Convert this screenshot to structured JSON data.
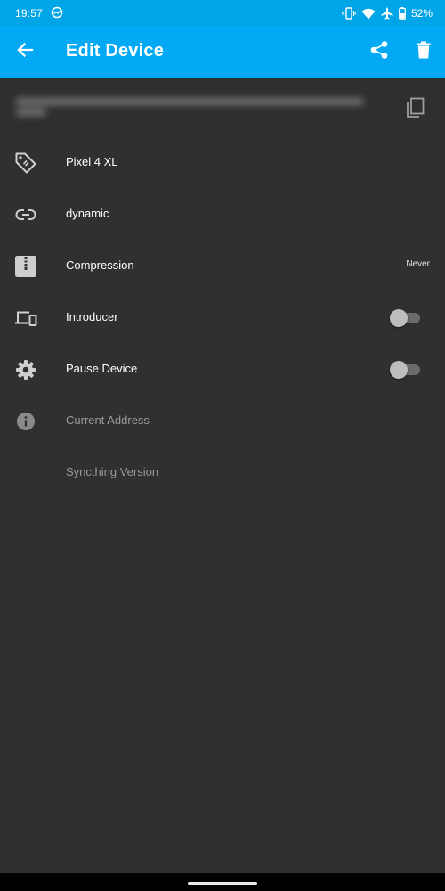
{
  "status_bar": {
    "time": "19:57",
    "battery_percent": "52%",
    "icons": [
      "sync-status-icon",
      "vibrate-icon",
      "wifi-icon",
      "airplane-mode-icon",
      "battery-icon"
    ]
  },
  "app_bar": {
    "title": "Edit Device",
    "background_color": "#03a9f4",
    "actions": [
      "back-arrow-icon",
      "share-icon",
      "delete-icon"
    ]
  },
  "device_id": {
    "copy_icon": "copy-icon"
  },
  "rows": {
    "name": {
      "label": "Pixel 4 XL",
      "icon": "tag-icon"
    },
    "addresses": {
      "label": "dynamic",
      "icon": "link-icon"
    },
    "compression": {
      "label": "Compression",
      "value": "Never",
      "icon": "zip-file-icon"
    },
    "introducer": {
      "label": "Introducer",
      "icon": "devices-icon",
      "toggle_on": false
    },
    "pause_device": {
      "label": "Pause Device",
      "icon": "gear-icon",
      "toggle_on": false
    },
    "current_address": {
      "label": "Current Address",
      "icon": "info-icon"
    },
    "syncthing_version": {
      "label": "Syncthing Version"
    }
  },
  "colors": {
    "status_bar": "#00a5e8",
    "background": "#303030",
    "text_primary": "#ffffff",
    "text_disabled": "#9a9a9a",
    "icon": "#cfcfcf"
  }
}
